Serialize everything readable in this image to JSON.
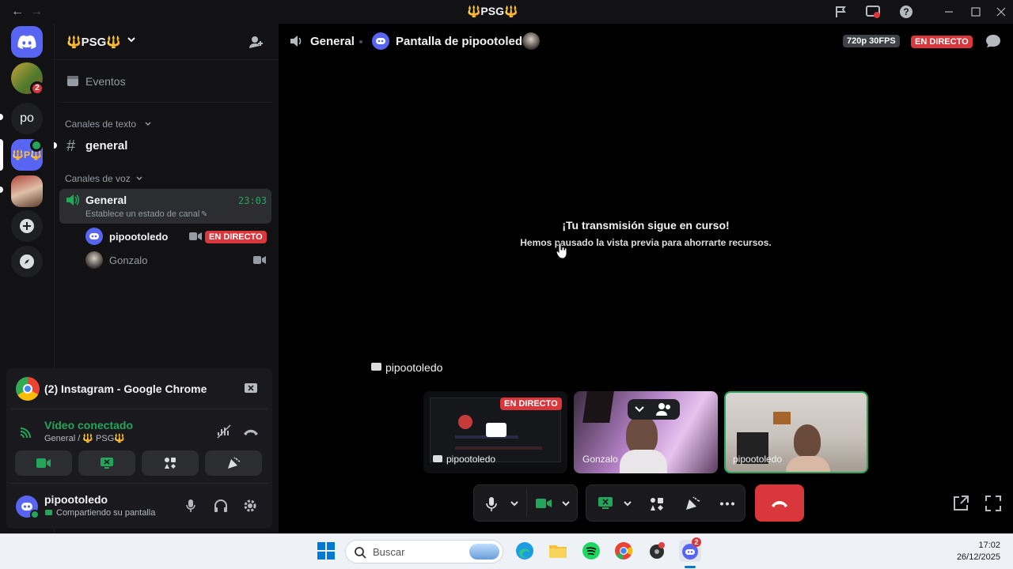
{
  "window": {
    "title": "🔱PSG🔱",
    "back_icon": "arrow-left-icon",
    "forward_icon": "arrow-right-icon"
  },
  "titlebar_icons": [
    "flag-icon",
    "inbox-screen-icon",
    "help-icon",
    "minimize-icon",
    "maximize-icon",
    "close-icon"
  ],
  "rail": {
    "servers": [
      {
        "name": "avatar-server",
        "badge": "2"
      },
      {
        "name": "po",
        "label": "po"
      },
      {
        "name": "psg-server",
        "label": "🔱P🔱"
      },
      {
        "name": "photo-server"
      }
    ],
    "add_icon": "plus-icon",
    "discover_icon": "compass-icon"
  },
  "sidebar": {
    "server_name": "🔱PSG🔱",
    "events": "Eventos",
    "text_category": "Canales de texto",
    "text_channel": "general",
    "voice_category": "Canales de voz",
    "voice_channel": "General",
    "voice_timer": "23:03",
    "voice_status": "Establece un estado de canal",
    "members": [
      {
        "name": "pipootoledo",
        "live": "EN DIRECTO"
      },
      {
        "name": "Gonzalo"
      }
    ]
  },
  "voice_panel": {
    "stream_title": "(2) Instagram - Google Chrome",
    "connected": "Vídeo conectado",
    "location": "General / 🔱 PSG🔱"
  },
  "user": {
    "name": "pipootoledo",
    "status": "Compartiendo su pantalla"
  },
  "main": {
    "channel": "General",
    "stream": "Pantalla de pipootoledo",
    "quality": "720p 30FPS",
    "live": "EN DIRECTO",
    "paused_title": "¡Tu transmisión sigue en curso!",
    "paused_sub": "Hemos pausado la vista previa para ahorrarte recursos.",
    "streamer": "pipootoledo",
    "tiles": [
      {
        "name": "pipootoledo",
        "live": "EN DIRECTO"
      },
      {
        "name": "Gonzalo"
      },
      {
        "name": "pipootoledo"
      }
    ]
  },
  "taskbar": {
    "search": "Buscar",
    "time": "17:02",
    "date": "26/12/2025",
    "discord_badge": "2"
  },
  "colors": {
    "green": "#23a55a",
    "red": "#da373c",
    "blurple": "#5865f2",
    "bg": "#121214"
  }
}
